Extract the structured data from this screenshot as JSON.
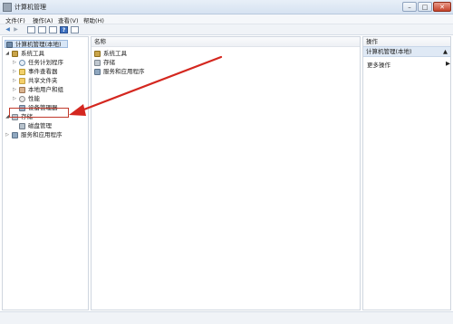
{
  "window": {
    "title": "计算机管理"
  },
  "menu": [
    "文件(F)",
    "操作(A)",
    "查看(V)",
    "帮助(H)"
  ],
  "tree": {
    "root": "计算机管理(本地)",
    "system_tools": "系统工具",
    "system_children": [
      "任务计划程序",
      "事件查看器",
      "共享文件夹",
      "本地用户和组",
      "性能",
      "设备管理器"
    ],
    "storage": "存储",
    "disk_management": "磁盘管理",
    "services": "服务和应用程序"
  },
  "content": {
    "column_header": "名称",
    "items": [
      "系统工具",
      "存储",
      "服务和应用程序"
    ]
  },
  "actions": {
    "header": "操作",
    "section_title": "计算机管理(本地)",
    "more": "更多操作"
  },
  "colors": {
    "accent": "#3b6fc0",
    "annotation": "#d4271f"
  }
}
